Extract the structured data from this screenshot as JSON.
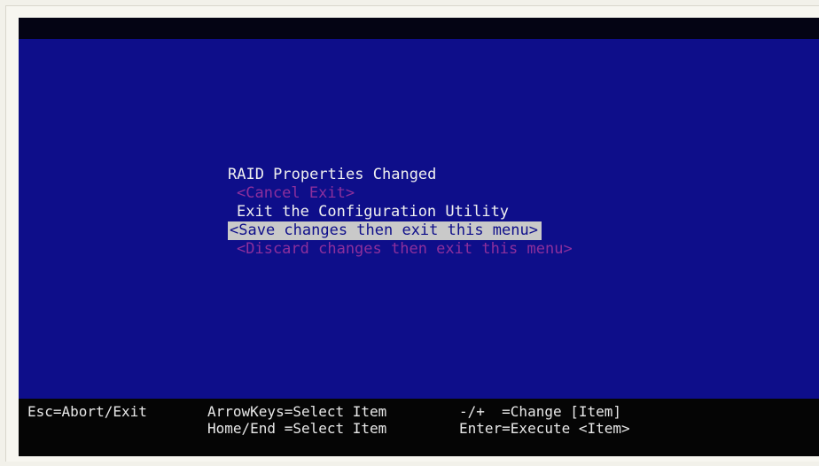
{
  "dialog": {
    "title": "RAID Properties Changed",
    "cancel_exit": "<Cancel Exit>",
    "exit_utility": "Exit the Configuration Utility",
    "save_exit": "<Save changes then exit this menu>",
    "discard_exit": "<Discard changes then exit this menu>"
  },
  "help": {
    "esc": "Esc=Abort/Exit",
    "arrow": "ArrowKeys=Select Item",
    "home_end": "Home/End =Select Item",
    "change": "-/+  =Change [Item]",
    "enter": "Enter=Execute <Item>"
  },
  "colors": {
    "screen_bg": "#0e0e8a",
    "disabled_text": "#8d2f9c",
    "selected_bg": "#c9c9c9"
  }
}
